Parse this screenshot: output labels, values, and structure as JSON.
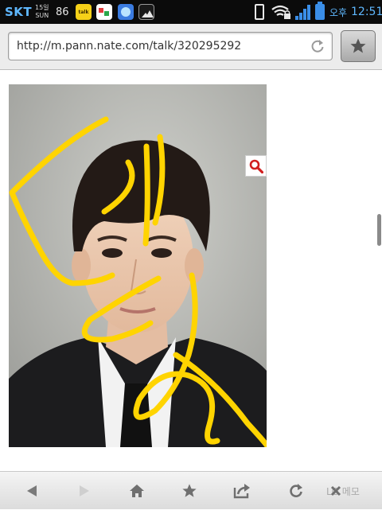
{
  "status_bar": {
    "carrier": "SKT",
    "date_day": "15일",
    "date_weekday": "SUN",
    "notification_count": "86",
    "talk_icon_text": "talk",
    "am_pm": "오후",
    "time": "12:51",
    "icons": [
      "kakaotalk-icon",
      "play-store-icon",
      "face-app-icon",
      "gallery-icon",
      "phone-vibrate-icon",
      "wifi-lock-icon",
      "signal-icon",
      "battery-icon"
    ]
  },
  "browser": {
    "url": "http://m.pann.nate.com/talk/320295292",
    "icons": [
      "reload-icon",
      "bookmark-star-icon",
      "zoom-magnifier-icon"
    ]
  },
  "content": {
    "image": "portrait photo with yellow handwritten doodle",
    "doodle_color": "#ffd400"
  },
  "toolbar": {
    "buttons": [
      "back-icon",
      "forward-icon",
      "home-icon",
      "bookmarks-icon",
      "share-icon",
      "refresh-icon"
    ],
    "memo_label": "LG 메모",
    "close_icon": "close-icon"
  },
  "colors": {
    "status_accent": "#5fb8ff",
    "toolbar_icon": "#7a7a7a",
    "zoom_icon": "#d11f1f"
  }
}
